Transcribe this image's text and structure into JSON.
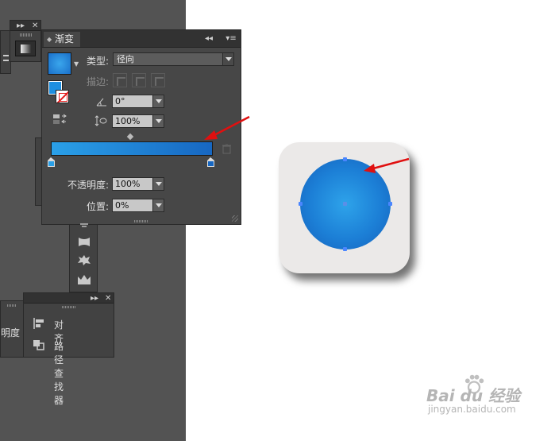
{
  "gradient_panel": {
    "title": "渐变",
    "type_label": "类型:",
    "type_value": "径向",
    "stroke_label": "描边:",
    "angle_value": "0°",
    "aspect_value": "100%",
    "opacity_label": "不透明度:",
    "opacity_value": "100%",
    "location_label": "位置:",
    "location_value": "0%",
    "gradient_start_color": "#2aa0e8",
    "gradient_end_color": "#1767c2"
  },
  "align_panel": {
    "items": [
      {
        "label": "对齐",
        "icon": "align-icon"
      },
      {
        "label": "路径查找器",
        "icon": "pathfinder-icon"
      }
    ]
  },
  "partial_panel_text": "明度",
  "artwork": {
    "icon_background": "#ebe9e8",
    "circle_center_color": "#2ea3ea",
    "circle_edge_color": "#1560bb"
  },
  "annotation_color": "#e01010",
  "watermark": {
    "brand": "Bai du 经验",
    "url": "jingyan.baidu.com"
  }
}
